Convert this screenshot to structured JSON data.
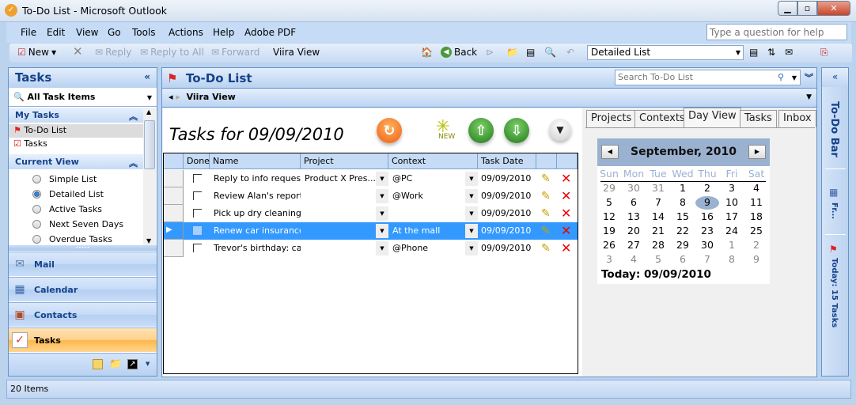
{
  "window": {
    "title": "To-Do List - Microsoft Outlook"
  },
  "menu": [
    "File",
    "Edit",
    "View",
    "Go",
    "Tools",
    "Actions",
    "Help",
    "Adobe PDF"
  ],
  "help_placeholder": "Type a question for help",
  "toolbar": {
    "new": "New",
    "reply": "Reply",
    "reply_all": "Reply to All",
    "forward": "Forward",
    "viira": "Viira View",
    "back": "Back",
    "view_select": "Detailed List"
  },
  "nav": {
    "title": "Tasks",
    "filter": "All Task Items",
    "my_tasks": "My Tasks",
    "my_items": [
      "To-Do List",
      "Tasks"
    ],
    "current_view": "Current View",
    "views": [
      {
        "label": "Simple List",
        "selected": false
      },
      {
        "label": "Detailed List",
        "selected": true
      },
      {
        "label": "Active Tasks",
        "selected": false
      },
      {
        "label": "Next Seven Days",
        "selected": false
      },
      {
        "label": "Overdue Tasks",
        "selected": false
      }
    ],
    "buttons": [
      "Mail",
      "Calendar",
      "Contacts",
      "Tasks"
    ]
  },
  "main": {
    "title": "To-Do List",
    "search_placeholder": "Search To-Do List",
    "subheader": "Viira View"
  },
  "tasks": {
    "heading": "Tasks for 09/09/2010",
    "new_label": "NEW",
    "columns": [
      "Done",
      "Name",
      "Project",
      "Context",
      "Task Date"
    ],
    "rows": [
      {
        "name": "Reply to info request",
        "project": "Product X Pres...",
        "context": "@PC",
        "date": "09/09/2010",
        "selected": false
      },
      {
        "name": "Review Alan's report",
        "project": "",
        "context": "@Work",
        "date": "09/09/2010",
        "selected": false
      },
      {
        "name": "Pick up dry cleaning",
        "project": "",
        "context": "",
        "date": "09/09/2010",
        "selected": false
      },
      {
        "name": "Renew car insurance",
        "project": "",
        "context": "At the mall",
        "date": "09/09/2010",
        "selected": true
      },
      {
        "name": "Trevor's birthday: call!",
        "project": "",
        "context": "@Phone",
        "date": "09/09/2010",
        "selected": false
      }
    ]
  },
  "side_tabs": [
    {
      "label": "Projects"
    },
    {
      "label": "Contexts"
    },
    {
      "label": "Day View",
      "selected": true
    },
    {
      "label": "Tasks"
    },
    {
      "label": "Inbox"
    }
  ],
  "calendar": {
    "month": "September, 2010",
    "days": [
      "Sun",
      "Mon",
      "Tue",
      "Wed",
      "Thu",
      "Fri",
      "Sat"
    ],
    "weeks": [
      [
        "29",
        "30",
        "31",
        "1",
        "2",
        "3",
        "4"
      ],
      [
        "5",
        "6",
        "7",
        "8",
        "9",
        "10",
        "11"
      ],
      [
        "12",
        "13",
        "14",
        "15",
        "16",
        "17",
        "18"
      ],
      [
        "19",
        "20",
        "21",
        "22",
        "23",
        "24",
        "25"
      ],
      [
        "26",
        "27",
        "28",
        "29",
        "30",
        "1",
        "2"
      ],
      [
        "3",
        "4",
        "5",
        "6",
        "7",
        "8",
        "9"
      ]
    ],
    "selected": "9",
    "today": "Today: 09/09/2010"
  },
  "todo_bar": {
    "title": "To-Do Bar",
    "calendar": "Fr...",
    "today": "Today: 15 Tasks"
  },
  "status": "20 Items"
}
